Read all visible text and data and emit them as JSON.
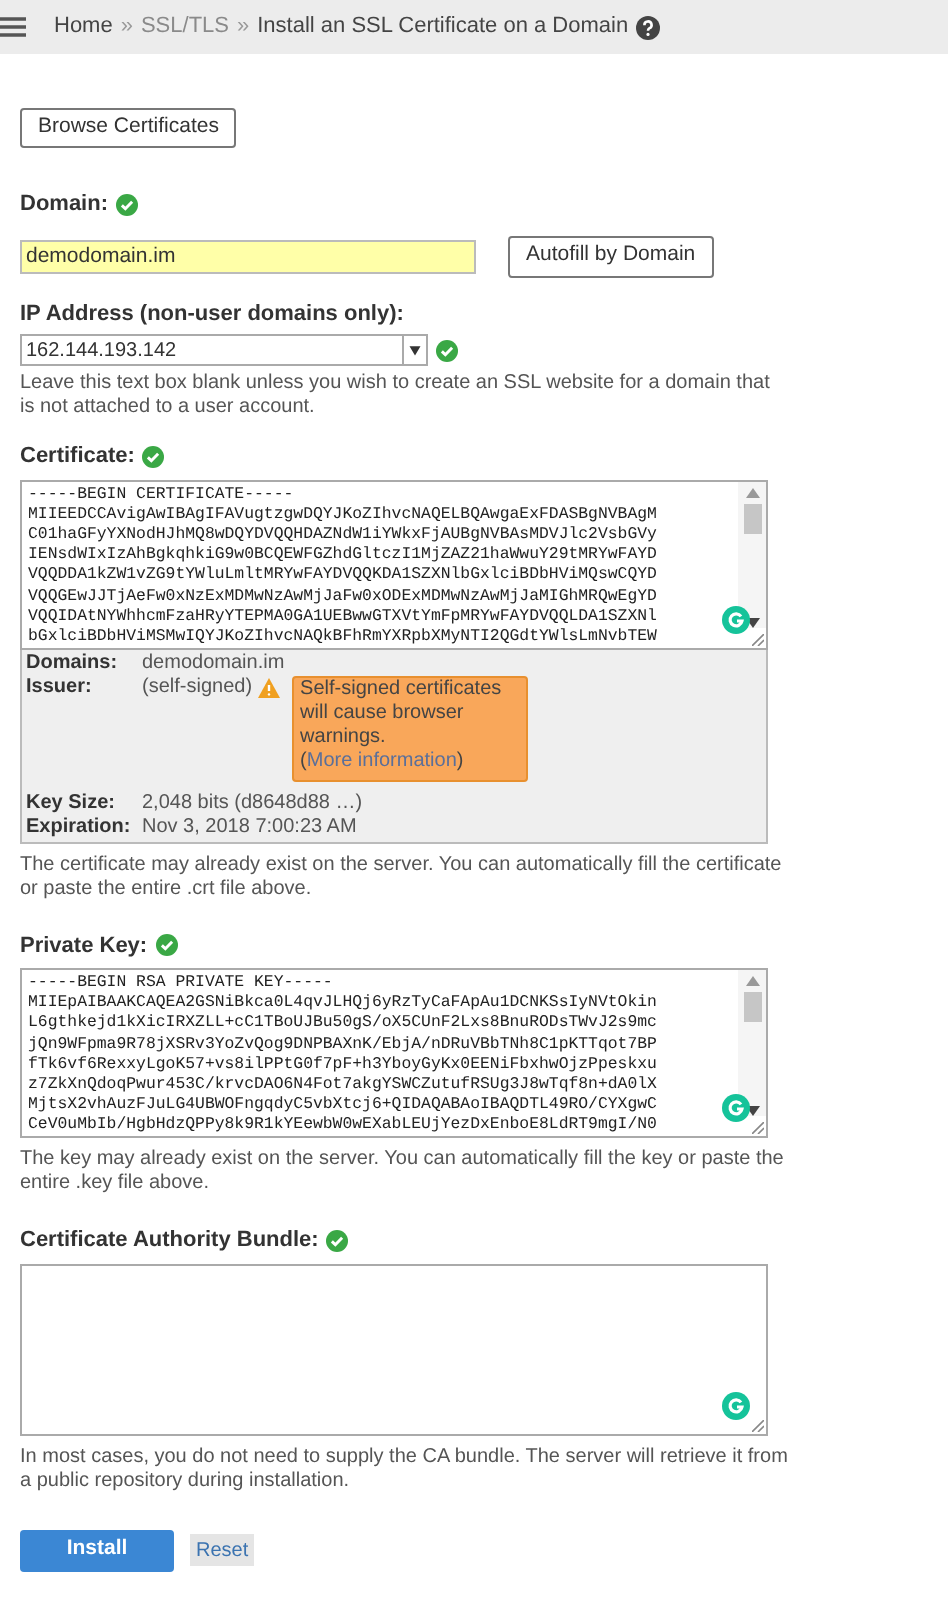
{
  "breadcrumb": {
    "items": [
      {
        "label": "Home",
        "kind": "current"
      },
      {
        "label": "SSL/TLS",
        "kind": "link"
      },
      {
        "label": "Install an SSL Certificate on a Domain",
        "kind": "current"
      }
    ],
    "separator": "»"
  },
  "browse_button": "Browse Certificates",
  "domain": {
    "label": "Domain:",
    "valid": true,
    "value": "demodomain.im",
    "button": "Autofill by Domain"
  },
  "ip": {
    "label": "IP Address (non-user domains only):",
    "valid": true,
    "value": "162.144.193.142",
    "help": "Leave this text box blank unless you wish to create an SSL website for a domain that is not attached to a user account."
  },
  "certificate": {
    "label": "Certificate:",
    "valid": true,
    "lines": [
      "-----BEGIN CERTIFICATE-----",
      "MIIEEDCCAvigAwIBAgIFAVugtzgwDQYJKoZIhvcNAQELBQAwgaExFDASBgNVBAgM",
      "C01haGFyYXNodHJhMQ8wDQYDVQQHDAZNdW1iYWkxFjAUBgNVBAsMDVJlc2VsbGVy",
      "IENsdWIxIzAhBgkqhkiG9w0BCQEWFGZhdGltczI1MjZAZ21haWwuY29tMRYwFAYD",
      "VQQDDA1kZW1vZG9tYWluLmltMRYwFAYDVQQKDA1SZXNlbGxlciBDbHViMQswCQYD",
      "VQQGEwJJTjAeFw0xNzExMDMwNzAwMjJaFw0xODExMDMwNzAwMjJaMIGhMRQwEgYD",
      "VQQIDAtNYWhhcmFzaHRyYTEPMA0GA1UEBwwGTXVtYmFpMRYwFAYDVQQLDA1SZXNl",
      "bGxlciBDbHViMSMwIQYJKoZIhvcNAQkBFhRmYXRpbXMyNTI2QGdtYWlsLmNvbTEW"
    ],
    "details": [
      {
        "label": "Domains:",
        "value": "demodomain.im"
      },
      {
        "label": "Issuer:",
        "value": "(self-signed)",
        "warning": true
      },
      {
        "label": "Key Size:",
        "value": "2,048 bits (d8648d88 …)"
      },
      {
        "label": "Expiration:",
        "value": "Nov 3, 2018 7:00:23 AM"
      }
    ],
    "warning_text": "Self-signed certificates will cause browser warnings. (",
    "warning_link": "More information",
    "warning_end": ")",
    "help": "The certificate may already exist on the server. You can automatically fill the certificate or paste the entire .crt file above."
  },
  "private_key": {
    "label": "Private Key:",
    "valid": true,
    "lines": [
      "-----BEGIN RSA PRIVATE KEY-----",
      "MIIEpAIBAAKCAQEA2GSNiBkca0L4qvJLHQj6yRzTyCaFApAu1DCNKSsIyNVtOkin",
      "L6gthkejd1kXicIRXZLL+cC1TBoUJBu50gS/oX5CUnF2Lxs8BnuRODsTWvJ2s9mc",
      "jQn9WFpma9R78jXSRv3YoZvQog9DNPBAXnK/EbjA/nDRuVBbTNh8C1pKTTqot7BP",
      "fTk6vf6RexxyLgoK57+vs8ilPPtG0f7pF+h3YboyGyKx0EENiFbxhwOjzPpeskxu",
      "z7ZkXnQdoqPwur453C/krvcDAO6N4Fot7akgYSWCZutufRSUg3J8wTqf8n+dA0lX",
      "MjtsX2vhAuzFJuLG4UBWOFngqdyC5vbXtcj6+QIDAQABAoIBAQDTL49RO/CYXgwC",
      "CeV0uMbIb/HgbHdzQPPy8k9R1kYEewbW0wEXabLEUjYezDxEnboE8LdRT9mgI/N0"
    ],
    "help": "The key may already exist on the server. You can automatically fill the key or paste the entire .key file above."
  },
  "ca_bundle": {
    "label": "Certificate Authority Bundle:",
    "valid": true,
    "help": "In most cases, you do not need to supply the CA bundle. The server will retrieve it from a public repository during installation."
  },
  "buttons": {
    "install": "Install",
    "reset": "Reset"
  }
}
